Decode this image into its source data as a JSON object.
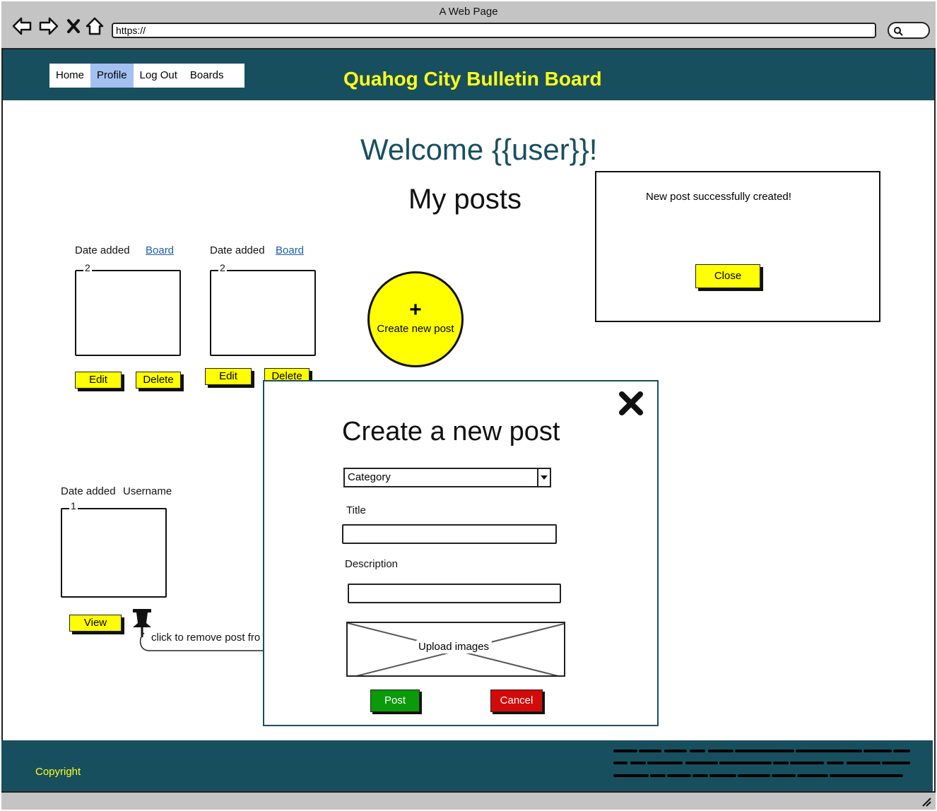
{
  "window": {
    "title": "A Web Page",
    "url": "https://"
  },
  "header": {
    "nav": [
      {
        "label": "Home",
        "active": false
      },
      {
        "label": "Profile",
        "active": true
      },
      {
        "label": "Log Out",
        "active": false
      },
      {
        "label": "Boards",
        "active": false
      }
    ],
    "site_title": "Quahog City Bulletin Board"
  },
  "main": {
    "welcome": "Welcome {{user}}!",
    "my_posts_title": "My posts",
    "my_posts": [
      {
        "date_label": "Date added",
        "board_link": "Board",
        "count": "2",
        "edit_label": "Edit",
        "delete_label": "Delete"
      },
      {
        "date_label": "Date added",
        "board_link": "Board",
        "count": "2",
        "edit_label": "Edit",
        "delete_label": "Delete"
      }
    ],
    "pinned_post": {
      "date_label": "Date added",
      "username_label": "Username",
      "count": "1",
      "view_label": "View",
      "pin_tooltip": "click to remove post fro"
    },
    "create_button": {
      "icon": "plus-icon",
      "label": "Create new post"
    }
  },
  "toast": {
    "message": "New post successfully created!",
    "close_label": "Close"
  },
  "modal": {
    "title": "Create a new post",
    "category_select": "Category",
    "title_label": "Title",
    "title_value": "",
    "description_label": "Description",
    "description_value": "",
    "upload_label": "Upload images",
    "post_label": "Post",
    "cancel_label": "Cancel"
  },
  "footer": {
    "copyright": "Copyright"
  },
  "colors": {
    "header_bg": "#184f5f",
    "accent_yellow": "#ffff00",
    "title_yellow": "#ffff1a",
    "nav_active": "#a3c0f0",
    "post_green": "#0a9a0a",
    "cancel_red": "#d20a0a"
  }
}
